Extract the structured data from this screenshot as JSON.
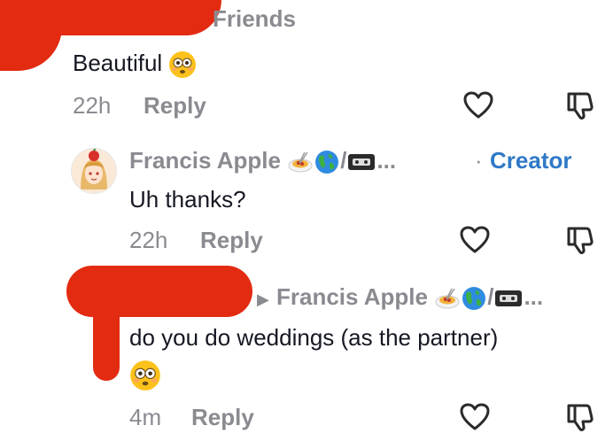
{
  "comment_main": {
    "friends_label": "Friends",
    "text": "Beautiful",
    "time": "22h",
    "reply_label": "Reply"
  },
  "reply_1": {
    "author": "Francis Apple",
    "author_suffix": "/",
    "ellipsis": "...",
    "creator_dot": "·",
    "creator_label": "Creator",
    "text": "Uh thanks?",
    "time": "22h",
    "reply_label": "Reply"
  },
  "reply_2": {
    "reply_to": "Francis Apple",
    "author_suffix": "/",
    "ellipsis": "...",
    "text": "do you do weddings (as the partner)",
    "time": "4m",
    "reply_label": "Reply"
  },
  "colors": {
    "creator": "#2f79c7",
    "muted": "#8a8b91",
    "text": "#161823",
    "redaction": "#e32b12"
  },
  "icons": [
    "heart-icon",
    "dislike-icon",
    "flushed-emoji",
    "spaghetti-emoji",
    "globe-emoji",
    "vhs-tape-emoji"
  ]
}
